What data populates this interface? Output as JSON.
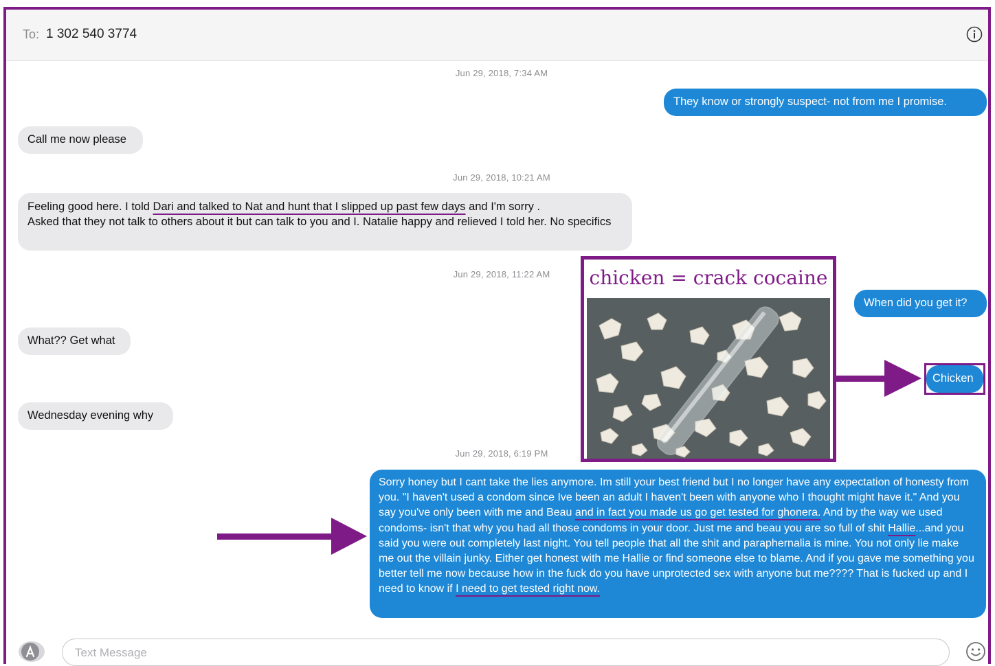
{
  "header": {
    "to_label": "To:",
    "recipient": "1 302 540 3774"
  },
  "timestamps": [
    "Jun 29, 2018, 7:34 AM",
    "Jun 29, 2018, 10:21 AM",
    "Jun 29, 2018, 11:22 AM",
    "Jun 29, 2018, 6:19 PM"
  ],
  "messages": {
    "m1": "They know or strongly suspect- not from me I promise.",
    "m2": "Call me now please",
    "m3_a": "Feeling good here. I told ",
    "m3_b": "Dari and talked to Nat and hunt that I slipped up past few days",
    "m3_c": " and I'm sorry .",
    "m3_d": "Asked that they not talk to others about it but can talk to you and I. Natalie happy and relieved I told her. No specifics",
    "m4": "When did you get it?",
    "m5": "What?? Get what",
    "m6": "Chicken",
    "m7": "Wednesday evening why",
    "m8_a": "Sorry honey but I cant take the lies anymore. Im still your best friend but I no longer have any expectation of honesty from you.  \"I haven't used a condom since Ive been an adult I haven't been with anyone who I thought might have it.\" And you say you've only been with me and Beau ",
    "m8_b": "and in fact you made us go get tested for ghonera.",
    "m8_c": "  And by the way we used condoms- isn't that why you had all those condoms in your door.  Just me and beau you are so full of shit ",
    "m8_d": "Hallie",
    "m8_e": "...and you said you were out completely last night. You tell people that all the shit and paraphernalia is mine. You not only lie make me out the villain junky.  Either get honest with me Hallie or find someone else to blame.  And if you gave me something you better tell me now because how in the fuck do you have unprotected sex with anyone but me???? That is fucked up and I need to know if ",
    "m8_f": "I need to get tested right now."
  },
  "annotation": {
    "title": "chicken = crack cocaine"
  },
  "compose": {
    "placeholder": "Text Message"
  },
  "colors": {
    "accent": "#7f1b87",
    "bubble_out": "#1e88d6",
    "bubble_in": "#e9e9eb"
  },
  "icons": [
    "info-icon",
    "app-store-icon",
    "emoji-icon",
    "arrow-icon"
  ]
}
